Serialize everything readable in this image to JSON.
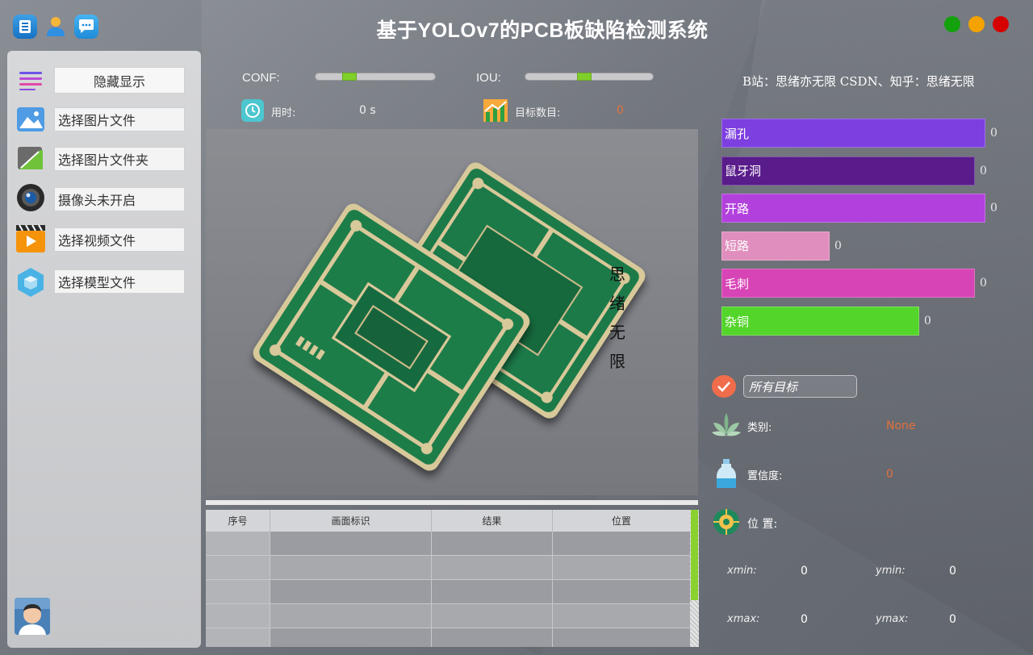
{
  "app": {
    "title": "基于YOLOv7的PCB板缺陷检测系统",
    "top_icons": [
      "book-icon",
      "user-icon",
      "chat-icon"
    ],
    "window_buttons": [
      {
        "name": "maximize",
        "color": "#13a10e"
      },
      {
        "name": "minimize",
        "color": "#f5a300"
      },
      {
        "name": "close",
        "color": "#d60000"
      }
    ]
  },
  "sidebar": {
    "toggle_label": "隐藏显示",
    "items": [
      {
        "icon": "image-icon",
        "label": "选择图片文件"
      },
      {
        "icon": "folder-icon",
        "label": "选择图片文件夹"
      },
      {
        "icon": "camera-icon",
        "label": "摄像头未开启"
      },
      {
        "icon": "video-icon",
        "label": "选择视频文件"
      },
      {
        "icon": "model-icon",
        "label": "选择模型文件"
      }
    ]
  },
  "controls": {
    "conf_label": "CONF:",
    "iou_label": "IOU:",
    "conf_value": 0.25,
    "iou_value": 0.45,
    "time_label": "用时:",
    "time_value": "0 s",
    "target_label": "目标数目:",
    "target_value": "0"
  },
  "image": {
    "watermark": [
      "思",
      "绪",
      "无",
      "限"
    ]
  },
  "table": {
    "headers": [
      "序号",
      "画面标识",
      "结果",
      "位置"
    ],
    "rows": 5
  },
  "right": {
    "site_text": "B站：思绪亦无限  CSDN、知乎：思绪无限",
    "bars": [
      {
        "label": "漏孔",
        "count": "0",
        "color": "#7d3fe0",
        "fraction": 1.0
      },
      {
        "label": "鼠牙洞",
        "count": "0",
        "color": "#591c8a",
        "fraction": 0.96
      },
      {
        "label": "开路",
        "count": "0",
        "color": "#b240dd",
        "fraction": 1.0
      },
      {
        "label": "短路",
        "count": "0",
        "color": "#df8ebd",
        "fraction": 0.41
      },
      {
        "label": "毛刺",
        "count": "0",
        "color": "#d744b5",
        "fraction": 0.96
      },
      {
        "label": "杂铜",
        "count": "0",
        "color": "#53d52a",
        "fraction": 0.75
      }
    ],
    "filter_value": "所有目标",
    "class_label": "类别:",
    "class_value": "None",
    "conf_label": "置信度:",
    "conf_value": "0",
    "position_label": "位 置:",
    "xmin_label": "xmin:",
    "xmin_value": "0",
    "ymin_label": "ymin:",
    "ymin_value": "0",
    "xmax_label": "xmax:",
    "xmax_value": "0",
    "ymax_label": "ymax:",
    "ymax_value": "0"
  }
}
